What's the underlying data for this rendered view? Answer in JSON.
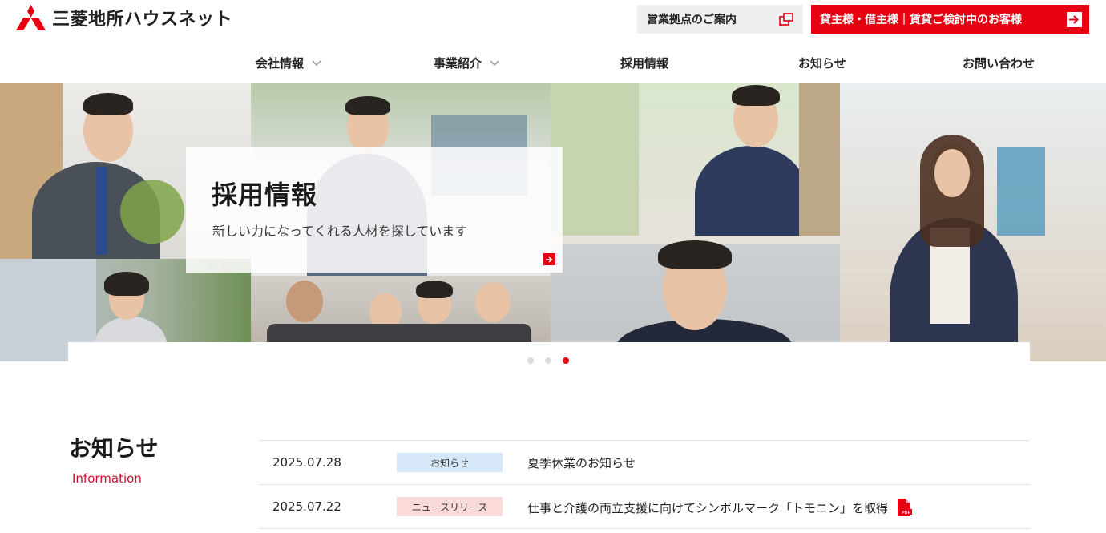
{
  "header": {
    "logo_text": "三菱地所ハウスネット",
    "office_button_label": "営業拠点のご案内",
    "owner_button_label": "貸主様・借主様｜賃貸ご検討中のお客様"
  },
  "nav": {
    "items": [
      {
        "label": "会社情報"
      },
      {
        "label": "事業紹介"
      },
      {
        "label": "採用情報"
      },
      {
        "label": "お知らせ"
      },
      {
        "label": "お問い合わせ"
      }
    ]
  },
  "hero": {
    "title": "採用情報",
    "subtitle": "新しい力になってくれる人材を探しています",
    "slide_count": 3,
    "active_slide": 3
  },
  "news": {
    "heading": "お知らせ",
    "heading_en": "Information",
    "items": [
      {
        "date": "2025.07.28",
        "tag": "お知らせ",
        "tag_color": "#d6e8f8",
        "title": "夏季休業のお知らせ",
        "pdf": false
      },
      {
        "date": "2025.07.22",
        "tag": "ニュースリリース",
        "tag_color": "#fbdada",
        "title": "仕事と介護の両立支援に向けてシンボルマーク「トモニン」を取得",
        "pdf": true
      }
    ]
  },
  "colors": {
    "brand_red": "#e60012",
    "accent_text_red": "#c8102e"
  }
}
